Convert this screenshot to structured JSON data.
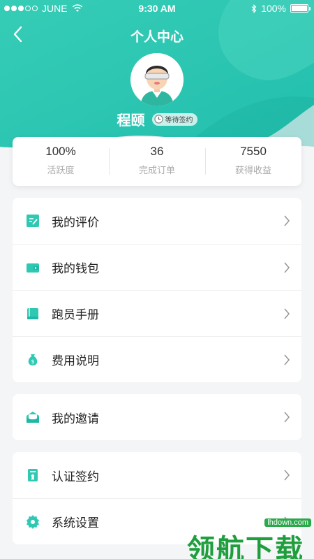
{
  "status_bar": {
    "carrier": "JUNE",
    "time": "9:30 AM",
    "battery": "100%"
  },
  "nav": {
    "title": "个人中心"
  },
  "profile": {
    "name": "程颐",
    "badge": "等待签约"
  },
  "stats": [
    {
      "value": "100%",
      "label": "活跃度"
    },
    {
      "value": "36",
      "label": "完成订单"
    },
    {
      "value": "7550",
      "label": "获得收益"
    }
  ],
  "menu_group_1": [
    {
      "label": "我的评价",
      "icon": "review-icon"
    },
    {
      "label": "我的钱包",
      "icon": "wallet-icon"
    },
    {
      "label": "跑员手册",
      "icon": "book-icon"
    },
    {
      "label": "费用说明",
      "icon": "money-bag-icon"
    }
  ],
  "menu_group_2": [
    {
      "label": "我的邀请",
      "icon": "invite-icon"
    }
  ],
  "menu_group_3": [
    {
      "label": "认证签约",
      "icon": "certificate-icon"
    },
    {
      "label": "系统设置",
      "icon": "gear-icon"
    }
  ],
  "watermark": {
    "brand": "领航下载",
    "domain": "lhdown.com"
  },
  "colors": {
    "accent": "#2fc9b3",
    "accent_dark": "#1fb7a6",
    "background": "#f4f5f7"
  }
}
